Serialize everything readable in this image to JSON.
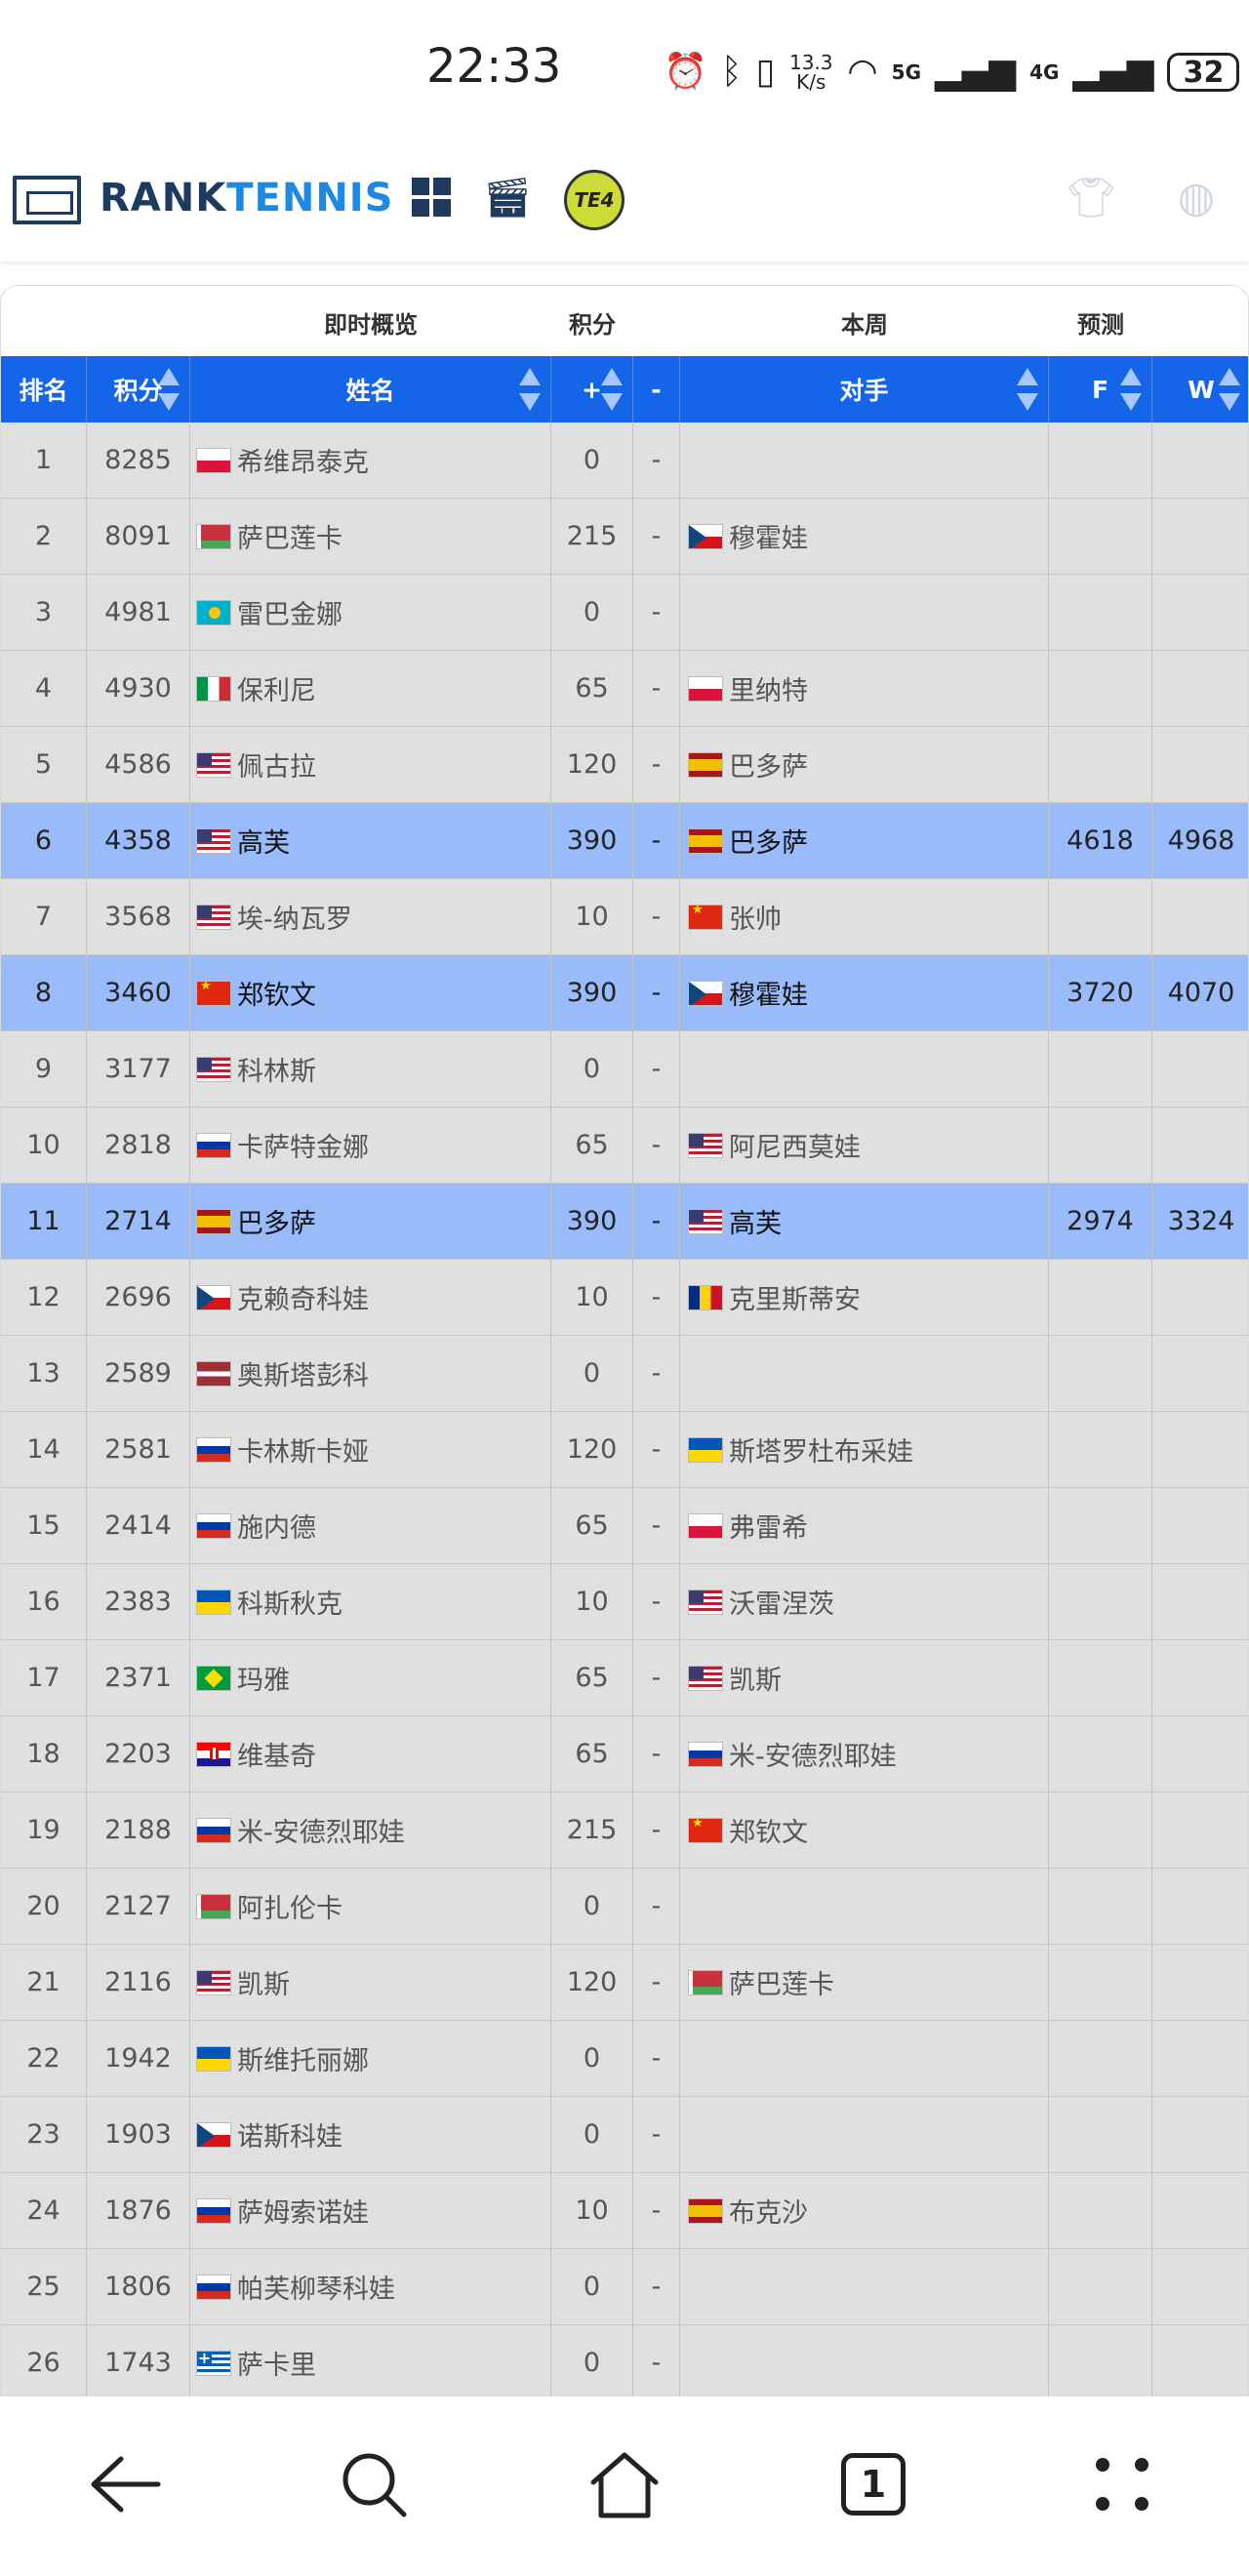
{
  "status_bar": {
    "time": "22:33",
    "net_speed_value": "13.3",
    "net_speed_unit": "K/s",
    "signal1_label": "5G",
    "signal2_label": "4G",
    "battery": "32"
  },
  "header": {
    "logo_rank": "RANK",
    "logo_tennis": "TENNIS",
    "te4_label": "TE4"
  },
  "table": {
    "group_headers": {
      "overview": "即时概览",
      "points": "积分",
      "this_week": "本周",
      "forecast": "预测"
    },
    "columns": {
      "rank": "排名",
      "points": "积分",
      "name": "姓名",
      "plus": "+",
      "minus": "-",
      "opponent": "对手",
      "f": "F",
      "w": "W"
    },
    "rows": [
      {
        "rank": "1",
        "points": "8285",
        "flag": "pl",
        "name": "希维昂泰克",
        "plus": "0",
        "minus": "-",
        "opp_flag": "",
        "opponent": "",
        "f": "",
        "w": "",
        "highlight": false
      },
      {
        "rank": "2",
        "points": "8091",
        "flag": "by",
        "name": "萨巴莲卡",
        "plus": "215",
        "minus": "-",
        "opp_flag": "cz",
        "opponent": "穆霍娃",
        "f": "",
        "w": "",
        "highlight": false
      },
      {
        "rank": "3",
        "points": "4981",
        "flag": "kz",
        "name": "雷巴金娜",
        "plus": "0",
        "minus": "-",
        "opp_flag": "",
        "opponent": "",
        "f": "",
        "w": "",
        "highlight": false
      },
      {
        "rank": "4",
        "points": "4930",
        "flag": "it",
        "name": "保利尼",
        "plus": "65",
        "minus": "-",
        "opp_flag": "pl",
        "opponent": "里纳特",
        "f": "",
        "w": "",
        "highlight": false
      },
      {
        "rank": "5",
        "points": "4586",
        "flag": "us",
        "name": "佩古拉",
        "plus": "120",
        "minus": "-",
        "opp_flag": "es",
        "opponent": "巴多萨",
        "f": "",
        "w": "",
        "highlight": false
      },
      {
        "rank": "6",
        "points": "4358",
        "flag": "us",
        "name": "高芙",
        "plus": "390",
        "minus": "-",
        "opp_flag": "es",
        "opponent": "巴多萨",
        "f": "4618",
        "w": "4968",
        "highlight": true
      },
      {
        "rank": "7",
        "points": "3568",
        "flag": "us",
        "name": "埃-纳瓦罗",
        "plus": "10",
        "minus": "-",
        "opp_flag": "cn",
        "opponent": "张帅",
        "f": "",
        "w": "",
        "highlight": false
      },
      {
        "rank": "8",
        "points": "3460",
        "flag": "cn",
        "name": "郑钦文",
        "plus": "390",
        "minus": "-",
        "opp_flag": "cz",
        "opponent": "穆霍娃",
        "f": "3720",
        "w": "4070",
        "highlight": true
      },
      {
        "rank": "9",
        "points": "3177",
        "flag": "us",
        "name": "科林斯",
        "plus": "0",
        "minus": "-",
        "opp_flag": "",
        "opponent": "",
        "f": "",
        "w": "",
        "highlight": false
      },
      {
        "rank": "10",
        "points": "2818",
        "flag": "ru",
        "name": "卡萨特金娜",
        "plus": "65",
        "minus": "-",
        "opp_flag": "us",
        "opponent": "阿尼西莫娃",
        "f": "",
        "w": "",
        "highlight": false
      },
      {
        "rank": "11",
        "points": "2714",
        "flag": "es",
        "name": "巴多萨",
        "plus": "390",
        "minus": "-",
        "opp_flag": "us",
        "opponent": "高芙",
        "f": "2974",
        "w": "3324",
        "highlight": true
      },
      {
        "rank": "12",
        "points": "2696",
        "flag": "cz",
        "name": "克赖奇科娃",
        "plus": "10",
        "minus": "-",
        "opp_flag": "ro",
        "opponent": "克里斯蒂安",
        "f": "",
        "w": "",
        "highlight": false
      },
      {
        "rank": "13",
        "points": "2589",
        "flag": "lv",
        "name": "奥斯塔彭科",
        "plus": "0",
        "minus": "-",
        "opp_flag": "",
        "opponent": "",
        "f": "",
        "w": "",
        "highlight": false
      },
      {
        "rank": "14",
        "points": "2581",
        "flag": "ru",
        "name": "卡林斯卡娅",
        "plus": "120",
        "minus": "-",
        "opp_flag": "ua",
        "opponent": "斯塔罗杜布采娃",
        "f": "",
        "w": "",
        "highlight": false
      },
      {
        "rank": "15",
        "points": "2414",
        "flag": "ru",
        "name": "施内德",
        "plus": "65",
        "minus": "-",
        "opp_flag": "pl",
        "opponent": "弗雷希",
        "f": "",
        "w": "",
        "highlight": false
      },
      {
        "rank": "16",
        "points": "2383",
        "flag": "ua",
        "name": "科斯秋克",
        "plus": "10",
        "minus": "-",
        "opp_flag": "us",
        "opponent": "沃雷涅茨",
        "f": "",
        "w": "",
        "highlight": false
      },
      {
        "rank": "17",
        "points": "2371",
        "flag": "br",
        "name": "玛雅",
        "plus": "65",
        "minus": "-",
        "opp_flag": "us",
        "opponent": "凯斯",
        "f": "",
        "w": "",
        "highlight": false
      },
      {
        "rank": "18",
        "points": "2203",
        "flag": "hr",
        "name": "维基奇",
        "plus": "65",
        "minus": "-",
        "opp_flag": "ru",
        "opponent": "米-安德烈耶娃",
        "f": "",
        "w": "",
        "highlight": false
      },
      {
        "rank": "19",
        "points": "2188",
        "flag": "ru",
        "name": "米-安德烈耶娃",
        "plus": "215",
        "minus": "-",
        "opp_flag": "cn",
        "opponent": "郑钦文",
        "f": "",
        "w": "",
        "highlight": false
      },
      {
        "rank": "20",
        "points": "2127",
        "flag": "by",
        "name": "阿扎伦卡",
        "plus": "0",
        "minus": "-",
        "opp_flag": "",
        "opponent": "",
        "f": "",
        "w": "",
        "highlight": false
      },
      {
        "rank": "21",
        "points": "2116",
        "flag": "us",
        "name": "凯斯",
        "plus": "120",
        "minus": "-",
        "opp_flag": "by",
        "opponent": "萨巴莲卡",
        "f": "",
        "w": "",
        "highlight": false
      },
      {
        "rank": "22",
        "points": "1942",
        "flag": "ua",
        "name": "斯维托丽娜",
        "plus": "0",
        "minus": "-",
        "opp_flag": "",
        "opponent": "",
        "f": "",
        "w": "",
        "highlight": false
      },
      {
        "rank": "23",
        "points": "1903",
        "flag": "cz",
        "name": "诺斯科娃",
        "plus": "0",
        "minus": "-",
        "opp_flag": "",
        "opponent": "",
        "f": "",
        "w": "",
        "highlight": false
      },
      {
        "rank": "24",
        "points": "1876",
        "flag": "ru",
        "name": "萨姆索诺娃",
        "plus": "10",
        "minus": "-",
        "opp_flag": "es",
        "opponent": "布克沙",
        "f": "",
        "w": "",
        "highlight": false
      },
      {
        "rank": "25",
        "points": "1806",
        "flag": "ru",
        "name": "帕芙柳琴科娃",
        "plus": "0",
        "minus": "-",
        "opp_flag": "",
        "opponent": "",
        "f": "",
        "w": "",
        "highlight": false
      },
      {
        "rank": "26",
        "points": "1743",
        "flag": "gr",
        "name": "萨卡里",
        "plus": "0",
        "minus": "-",
        "opp_flag": "",
        "opponent": "",
        "f": "",
        "w": "",
        "highlight": false
      }
    ]
  },
  "bottom_nav": {
    "tab_count": "1"
  },
  "colors": {
    "header_blue": "#1565e8",
    "row_bg": "#e0e0e0",
    "row_highlight": "#99bbf9",
    "logo_dark": "#1f3a5f",
    "logo_light": "#1e88e5"
  },
  "icons": [
    "alarm-icon",
    "bluetooth-icon",
    "vibrate-icon",
    "wifi-icon",
    "signal-icon",
    "battery-icon",
    "leaf-icon",
    "grid-icon",
    "video-icon",
    "shirt-icon",
    "globe-icon",
    "back-icon",
    "search-icon",
    "home-icon",
    "tabs-icon",
    "menu-icon"
  ]
}
